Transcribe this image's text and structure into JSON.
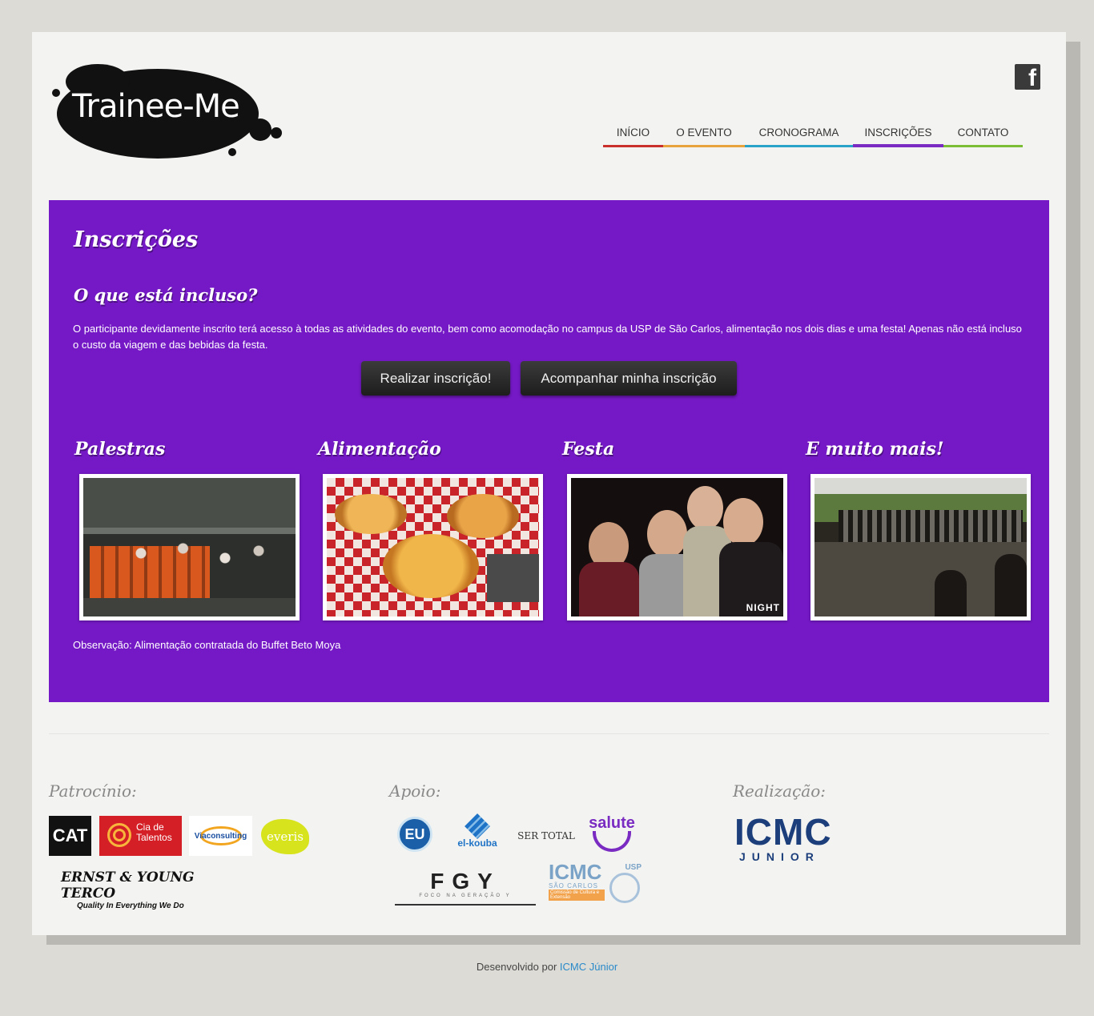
{
  "header": {
    "logo_text": "Trainee-Me",
    "social_icon": "facebook-icon",
    "nav": [
      {
        "label": "INÍCIO",
        "color": "#c9302c"
      },
      {
        "label": "O EVENTO",
        "color": "#e8a33d"
      },
      {
        "label": "CRONOGRAMA",
        "color": "#2aa3c9"
      },
      {
        "label": "INSCRIÇÕES",
        "color": "#7a2bc2",
        "active": true
      },
      {
        "label": "CONTATO",
        "color": "#7bbe35"
      }
    ]
  },
  "main": {
    "title": "Inscrições",
    "subtitle": "O que está incluso?",
    "description": "O participante devidamente inscrito terá acesso à todas as atividades do evento, bem como acomodação no campus da USP de São Carlos, alimentação nos dois dias e uma festa! Apenas não está incluso o custo da viagem e das bebidas da festa.",
    "buttons": {
      "register": "Realizar inscrição!",
      "track": "Acompanhar minha inscrição"
    },
    "features": [
      {
        "title": "Palestras"
      },
      {
        "title": "Alimentação"
      },
      {
        "title": "Festa",
        "watermark": "NIGHT"
      },
      {
        "title": "E muito mais!"
      }
    ],
    "note": "Observação: Alimentação contratada do Buffet Beto Moya",
    "accent_color": "#7419c5"
  },
  "sponsors": {
    "patrocinio": {
      "title": "Patrocínio:",
      "logos": {
        "cat": "CAT",
        "cia_line1": "Cia de",
        "cia_line2": "Talentos",
        "via": "Viaconsulting",
        "everis": "everis",
        "ey_line1": "ERNST & YOUNG TERCO",
        "ey_line2": "Quality In Everything We Do"
      }
    },
    "apoio": {
      "title": "Apoio:",
      "logos": {
        "eu": "EU",
        "elkouba": "el-kouba",
        "sertotal": "SER TOTAL",
        "salute": "salute",
        "fgy": "FGY",
        "fgy_tag": "FOCO NA GERAÇÃO Y",
        "icmc": "ICMC",
        "icmc_sub": "SÃO CARLOS",
        "icmc_tag": "Comissão de Cultura e Extensão",
        "usp": "USP"
      }
    },
    "realizacao": {
      "title": "Realização:",
      "logo_main": "ICMC",
      "logo_sub": "JUNIOR"
    }
  },
  "footer": {
    "prefix": "Desenvolvido por",
    "link": "ICMC Júnior"
  }
}
